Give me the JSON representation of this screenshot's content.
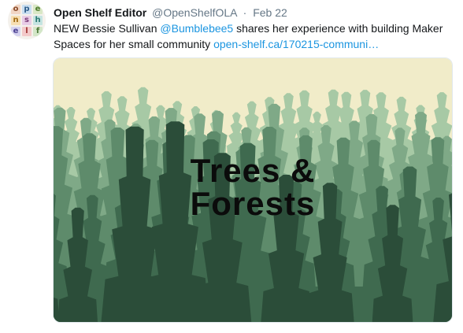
{
  "tweet": {
    "author_name": "Open Shelf Editor",
    "author_handle": "@OpenShelfOLA",
    "separator": "·",
    "date": "Feb 22",
    "text_before_mention": "NEW Bessie Sullivan ",
    "mention": "@Bumblebee5",
    "text_after_mention": " shares her experience with building Maker Spaces for her small community ",
    "link": "open-shelf.ca/170215-communi…",
    "avatar_letters": [
      "o",
      "p",
      "e",
      "n",
      "s",
      "h",
      "e",
      "l",
      "f"
    ],
    "avatar_colors": [
      "#f1d6c5",
      "#c9def0",
      "#d9e8c6",
      "#f7dfb3",
      "#e8cde6",
      "#c5e4e1",
      "#d6d3ef",
      "#f3c9c9",
      "#d3e6c8"
    ]
  },
  "media": {
    "title_line1": "Trees &",
    "title_line2": "Forests",
    "colors": {
      "sky": "#f1ecc9",
      "layer1": "#a7c9a5",
      "layer2": "#7fa987",
      "layer3": "#5e8b6b",
      "layer4": "#3f6a4f",
      "layer5": "#2b4d39"
    }
  }
}
